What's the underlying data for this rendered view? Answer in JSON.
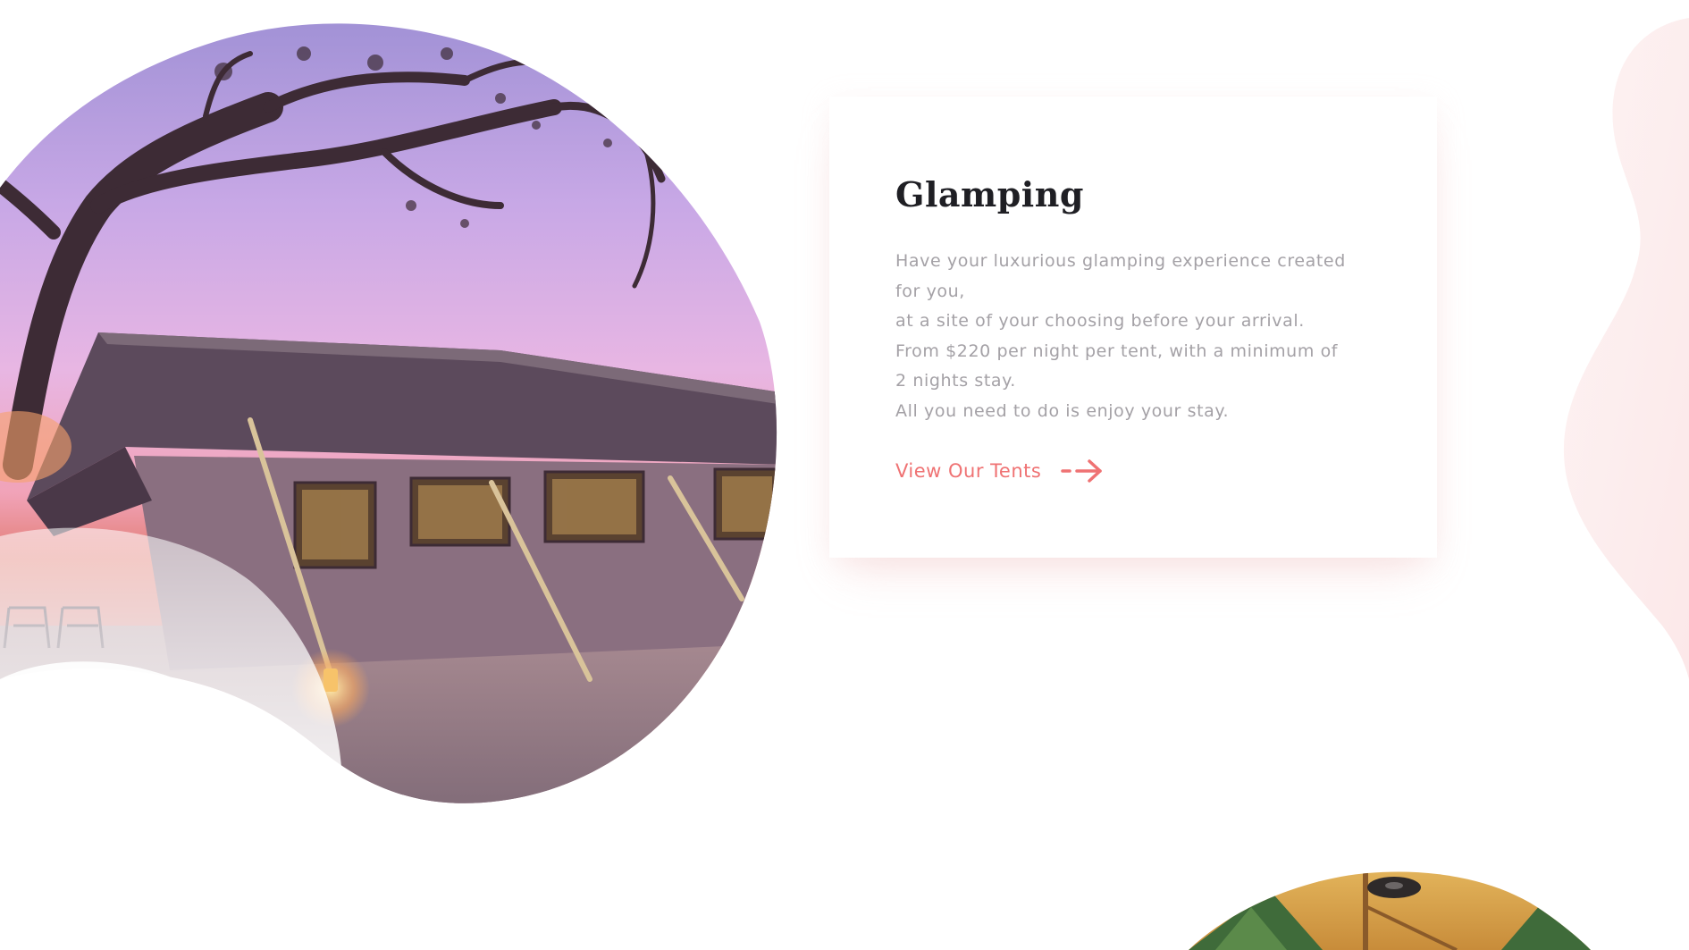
{
  "colors": {
    "accent": "#ef7273",
    "title": "#1f1f24",
    "body_text": "#a4a1a6",
    "blob_tint": "#fbe9ea"
  },
  "feature_card": {
    "title": "Glamping",
    "description_lines": [
      "Have your luxurious glamping experience created",
      "for you,",
      "at a site of your choosing before your arrival.",
      "From $220 per night per tent, with a minimum of",
      "2 nights stay.",
      "All you need to do is enjoy your stay."
    ],
    "cta_label": "View Our Tents",
    "cta_icon": "arrow-right-icon"
  },
  "images": {
    "hero_image": "glamping-tent-photo",
    "secondary_image": "tent-interior-photo"
  }
}
